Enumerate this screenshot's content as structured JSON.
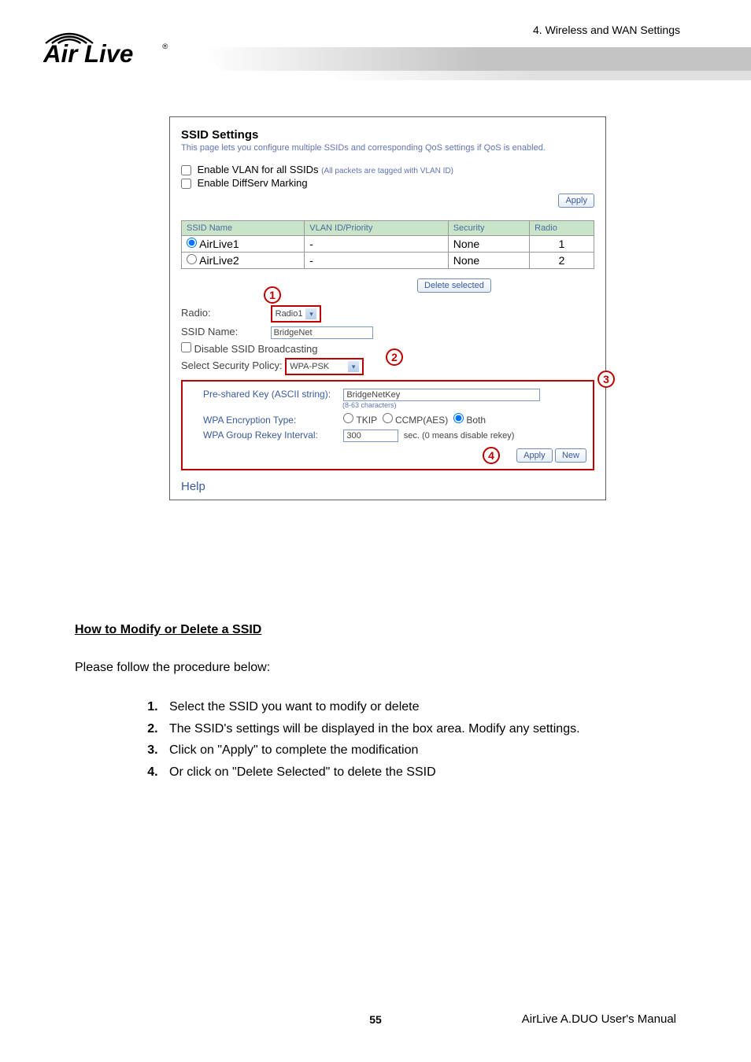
{
  "header": {
    "section_label": "4. Wireless and WAN Settings",
    "logo_text": "Air Live",
    "logo_registered": "®"
  },
  "panel": {
    "title": "SSID Settings",
    "description": "This page lets you configure multiple SSIDs and corresponding QoS settings if QoS is enabled.",
    "enable_vlan_label": "Enable VLAN for all SSIDs",
    "enable_vlan_note": "(All packets are tagged with VLAN ID)",
    "enable_diffserv_label": "Enable DiffServ Marking",
    "apply_btn": "Apply",
    "table": {
      "headers": [
        "SSID Name",
        "VLAN ID/Priority",
        "Security",
        "Radio"
      ],
      "rows": [
        {
          "selected": true,
          "name": "AirLive1",
          "vlan": "-",
          "security": "None",
          "radio": "1"
        },
        {
          "selected": false,
          "name": "AirLive2",
          "vlan": "-",
          "security": "None",
          "radio": "2"
        }
      ]
    },
    "delete_selected_btn": "Delete selected",
    "form": {
      "radio_label": "Radio:",
      "radio_value": "Radio1",
      "ssid_label": "SSID Name:",
      "ssid_value": "BridgeNet",
      "disable_broadcast_label": "Disable SSID Broadcasting",
      "policy_label": "Select Security Policy:",
      "policy_value": "WPA-PSK",
      "psk_label": "Pre-shared Key (ASCII string):",
      "psk_value": "BridgeNetKey",
      "psk_note": "(8-63 characters)",
      "enc_label": "WPA Encryption Type:",
      "enc_options": {
        "tkip": "TKIP",
        "ccmp": "CCMP(AES)",
        "both": "Both"
      },
      "enc_selected": "both",
      "rekey_label": "WPA Group Rekey Interval:",
      "rekey_value": "300",
      "rekey_unit": "sec.",
      "rekey_note": "(0 means disable rekey)",
      "apply2_btn": "Apply",
      "new_btn": "New"
    },
    "help_link": "Help",
    "callouts": {
      "c1": "1",
      "c2": "2",
      "c3": "3",
      "c4": "4"
    }
  },
  "content": {
    "heading": "How to Modify or Delete a SSID",
    "intro": "Please follow the procedure below:",
    "steps": [
      "Select the SSID you want to modify or delete",
      "The SSID's settings will be displayed in the box area. Modify any settings.",
      "Click on \"Apply\" to complete the modification",
      "Or click on \"Delete Selected\" to delete the SSID"
    ]
  },
  "footer": {
    "page_number": "55",
    "manual_title": "AirLive A.DUO User's Manual"
  }
}
